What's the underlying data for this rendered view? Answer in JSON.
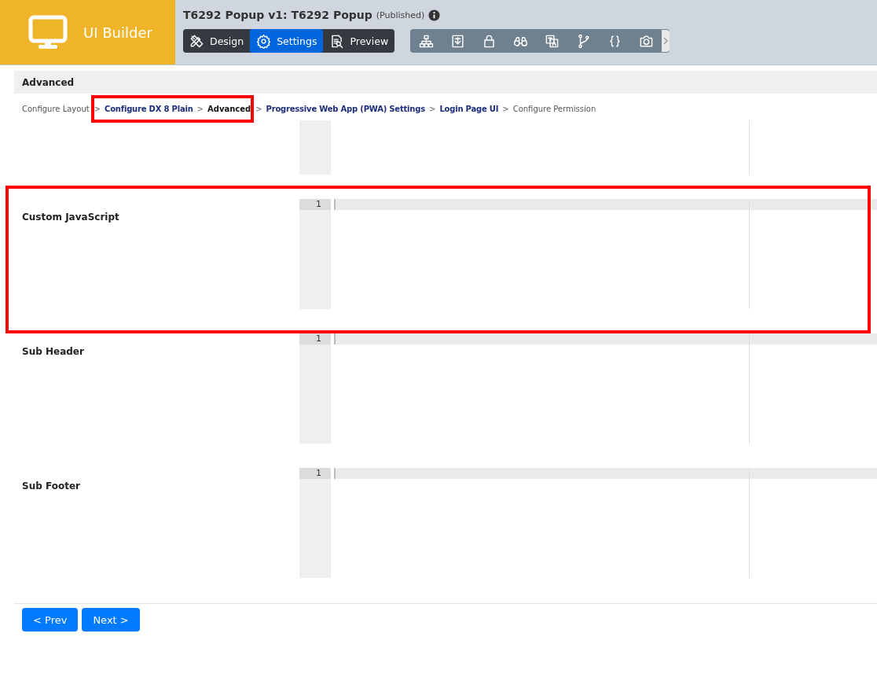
{
  "brand": {
    "name": "UI Builder"
  },
  "header": {
    "title": "T6292 Popup v1: T6292 Popup",
    "status": "(Published)"
  },
  "mode_tabs": [
    {
      "label": "Design",
      "selected": false
    },
    {
      "label": "Settings",
      "selected": true
    },
    {
      "label": "Preview",
      "selected": false
    }
  ],
  "section": {
    "title": "Advanced"
  },
  "breadcrumb": [
    {
      "label": "Configure Layout",
      "kind": "done",
      "highlighted": false
    },
    {
      "separator": ">",
      "label": "Configure DX 8 Plain",
      "kind": "link",
      "highlighted": true
    },
    {
      "separator": ">",
      "label": "Advanced",
      "kind": "current",
      "highlighted": true
    },
    {
      "separator": ">",
      "label": "Progressive Web App (PWA) Settings",
      "kind": "link",
      "highlighted": false
    },
    {
      "separator": ">",
      "label": "Login Page UI",
      "kind": "link",
      "highlighted": false
    },
    {
      "separator": ">",
      "label": "Configure Permission",
      "kind": "todo",
      "highlighted": false
    }
  ],
  "fields": [
    {
      "kind": "scrolled"
    },
    {
      "kind": "editor",
      "label": "Custom JavaScript",
      "line_number": "1",
      "highlighted": true
    },
    {
      "kind": "editor",
      "label": "Sub Header",
      "line_number": "1",
      "highlighted": false
    },
    {
      "kind": "editor",
      "label": "Sub Footer",
      "line_number": "1",
      "highlighted": false
    }
  ],
  "buttons": [
    "< Prev",
    "Next >"
  ]
}
